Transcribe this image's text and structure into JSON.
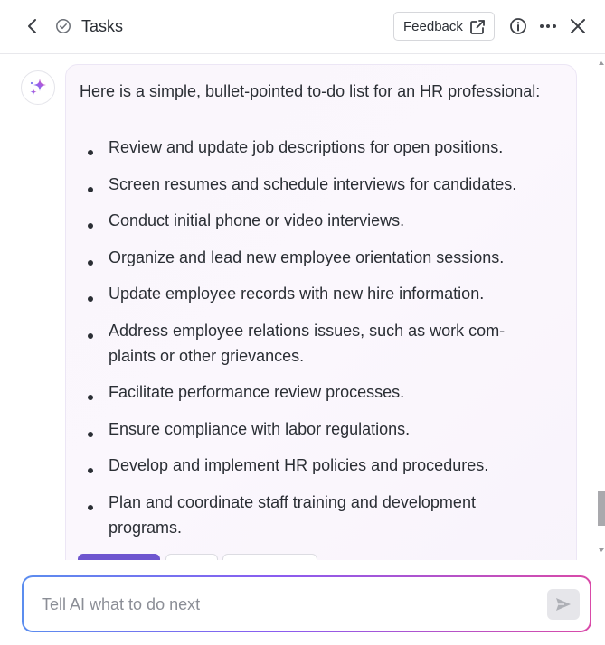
{
  "header": {
    "title": "Tasks",
    "feedback_label": "Feedback"
  },
  "message": {
    "intro": "Here is a simple, bullet-pointed to-do list for an HR professional:",
    "items": [
      "Review and update job descriptions for open positions.",
      "Screen resumes and schedule interviews for candidates.",
      "Conduct initial phone or video interviews.",
      "Organize and lead new employee orientation sessions.",
      "Update employee records with new hire information.",
      "Address employee relations issues, such as work com-\nplaints or other grievances.",
      "Facilitate performance review processes.",
      "Ensure compliance with labor regulations.",
      "Develop and implement HR policies and procedures.",
      "Plan and coordinate staff training and development\nprograms."
    ]
  },
  "composer": {
    "placeholder": "Tell AI what to do next"
  },
  "colors": {
    "accent": "#6e56cf",
    "gradient_start": "#5b8def",
    "gradient_mid": "#8a5cf0",
    "gradient_end": "#d94aa8"
  },
  "icons": {
    "back": "chevron-left-icon",
    "task": "check-circle-icon",
    "external": "external-link-icon",
    "info": "info-icon",
    "more": "more-dots-icon",
    "close": "close-icon",
    "ai": "sparkle-icon",
    "send": "send-icon"
  }
}
